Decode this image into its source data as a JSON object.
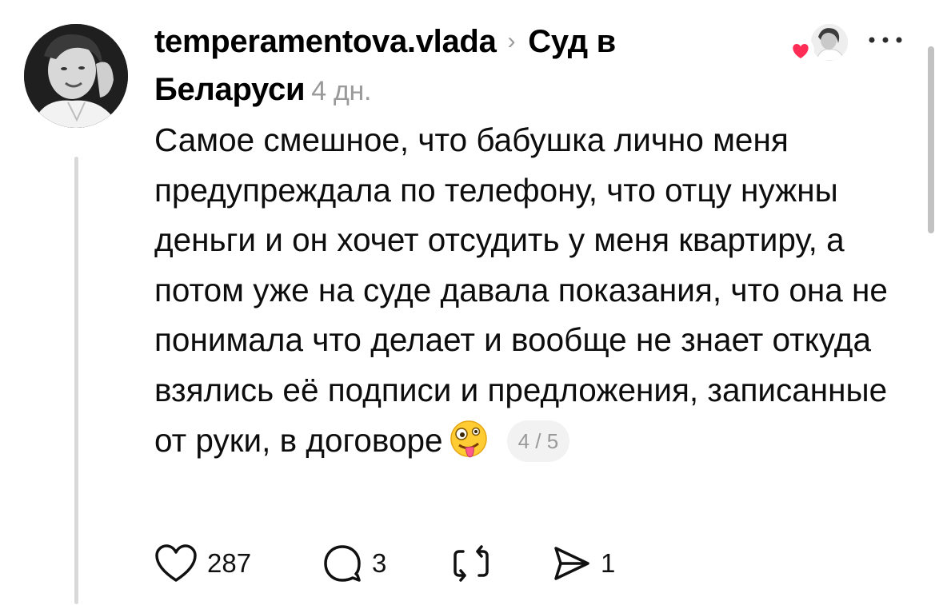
{
  "post": {
    "author": "temperamentova.vlada",
    "separator": "›",
    "community": "Суд в Беларуси",
    "time": "4 дн.",
    "text": "Самое смешное, что бабушка лично меня предупреждала по телефону, что отцу нужны деньги и он хочет отсудить у меня квартиру, а потом уже на суде давала показания, что она не понимала что делает и вообще не знает откуда взялись её подписи и предложения, записанные от руки, в договоре",
    "emoji": "zany-face",
    "pager": "4 / 5",
    "liked_by_icon": "heart-icon"
  },
  "actions": {
    "likes": "287",
    "replies": "3",
    "reposts": "",
    "shares": "1"
  },
  "icons": {
    "like": "heart-outline-icon",
    "reply": "speech-bubble-icon",
    "repost": "repost-icon",
    "share": "send-icon",
    "more": "ellipsis-icon"
  },
  "colors": {
    "heart_badge": "#ff2d55",
    "secondary_text": "#9a9a9a",
    "thread_line": "#d9d9d9"
  }
}
